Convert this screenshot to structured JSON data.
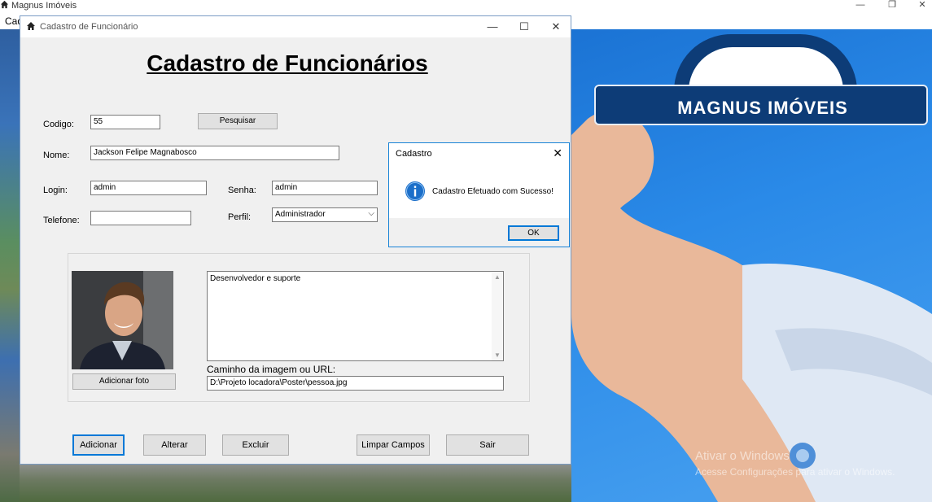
{
  "main_window": {
    "title": "Magnus Imóveis",
    "menu_item": "Cad",
    "controls": {
      "minimize": "—",
      "maximize": "❐",
      "close": "✕"
    }
  },
  "background": {
    "logo_text": "MAGNUS IMÓVEIS",
    "watermark_line1": "Ativar o Windows",
    "watermark_line2": "Acesse Configurações para ativar o Windows."
  },
  "form": {
    "title": "Cadastro de Funcionário",
    "controls": {
      "minimize": "—",
      "maximize": "☐",
      "close": "✕"
    },
    "heading": "Cadastro de Funcionários",
    "codigo": {
      "label": "Codigo:",
      "value": "55"
    },
    "search_button": "Pesquisar",
    "nome": {
      "label": "Nome:",
      "value": "Jackson Felipe Magnabosco"
    },
    "login": {
      "label": "Login:",
      "value": "admin"
    },
    "senha": {
      "label": "Senha:",
      "value": "admin"
    },
    "telefone": {
      "label": "Telefone:",
      "value": ""
    },
    "perfil": {
      "label": "Perfil:",
      "value": "Administrador"
    },
    "description": "Desenvolvedor e suporte",
    "image_path": {
      "label": "Caminho da imagem ou URL:",
      "value": "D:\\Projeto locadora\\Poster\\pessoa.jpg"
    },
    "add_photo_button": "Adicionar foto",
    "buttons": {
      "add": "Adicionar",
      "edit": "Alterar",
      "delete": "Excluir",
      "clear": "Limpar Campos",
      "exit": "Sair"
    }
  },
  "message_box": {
    "title": "Cadastro",
    "close": "✕",
    "message": "Cadastro Efetuado com Sucesso!",
    "ok_button": "OK"
  }
}
